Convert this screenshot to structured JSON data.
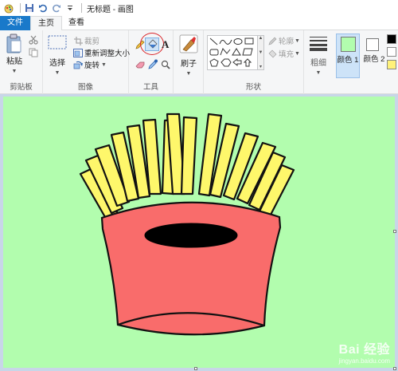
{
  "titlebar": {
    "title": "无标题 - 画图",
    "icons": [
      "paint-app-icon",
      "save-icon",
      "undo-icon",
      "redo-icon",
      "customize-dropdown-icon"
    ]
  },
  "tabs": [
    {
      "label": "文件"
    },
    {
      "label": "主页"
    },
    {
      "label": "查看"
    }
  ],
  "groups": {
    "clipboard": {
      "label": "剪贴板",
      "paste": "粘贴",
      "cut_icon": "scissors-icon",
      "copy_icon": "copy-icon"
    },
    "image": {
      "label": "图像",
      "select": "选择",
      "crop": "裁剪",
      "resize": "重新调整大小",
      "rotate": "旋转"
    },
    "tools": {
      "label": "工具",
      "items": [
        "pencil-icon",
        "fill-bucket-icon",
        "text-icon",
        "eraser-icon",
        "color-picker-icon",
        "magnifier-icon"
      ],
      "highlight_color": "#d9262b"
    },
    "brushes": {
      "label": "刷子"
    },
    "shapes": {
      "label": "形状",
      "outline": "轮廓",
      "fill": "填充"
    },
    "size": {
      "label": "粗细"
    },
    "colors": {
      "color1_label": "颜色 1",
      "color2_label": "颜色 2",
      "color1": "#b2fdae",
      "color2": "#ffffff",
      "palette": [
        "#000000",
        "#ffffff",
        "#fff27a"
      ]
    }
  },
  "canvas": {
    "background": "#b2fdae",
    "fries_color": "#fef76b",
    "box_color": "#f96c6b",
    "hole_color": "#000000"
  },
  "watermark": {
    "main": "Bai 经验",
    "sub": "jingyan.baidu.com"
  }
}
